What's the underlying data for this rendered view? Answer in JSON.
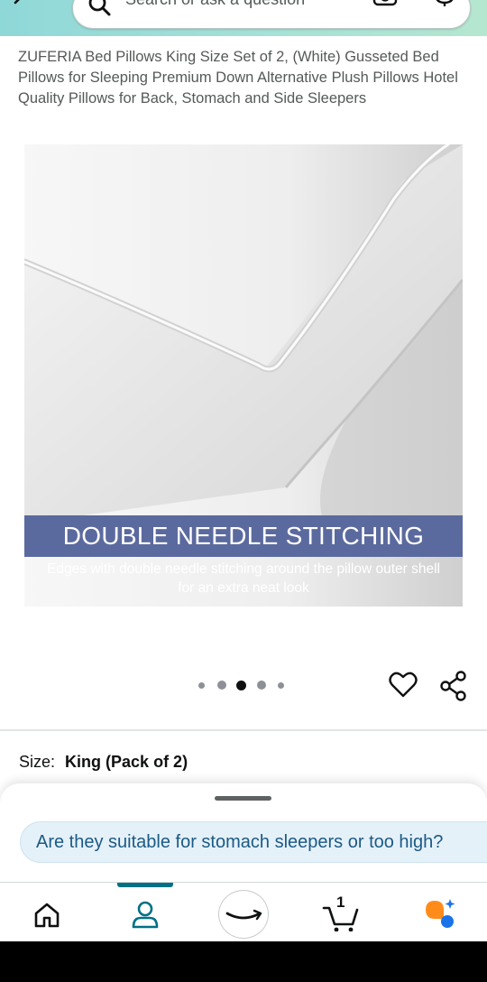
{
  "header": {
    "search_placeholder": "Search or ask a question",
    "back_icon": "chevron-left-icon",
    "search_icon": "search-icon",
    "camera_icon": "camera-lens-icon",
    "mic_icon": "microphone-icon",
    "gradient_colors": [
      "#8fd8d8",
      "#b5e6d0"
    ]
  },
  "product": {
    "title": "ZUFERIA Bed Pillows King Size Set of 2, (White) Gusseted Bed Pillows for Sleeping Premium Down Alternative Plush Pillows Hotel Quality Pillows for Back, Stomach and Side Sleepers",
    "image": {
      "banner_text": "DOUBLE NEEDLE STITCHING",
      "caption": "Edges with double needle stitching around the pillow outer shell for an extra neat look",
      "banner_color": "#5b6a9e"
    },
    "carousel": {
      "total": 5,
      "active_index": 2
    },
    "size_label": "Size:",
    "size_value": "King (Pack of 2)"
  },
  "sheet": {
    "question": "Are they suitable for stomach sleepers or too high?"
  },
  "nav": {
    "items": [
      "home-icon",
      "account-icon",
      "amazon-smile-icon",
      "cart-icon",
      "menu-icon"
    ],
    "active_index": 1,
    "cart_count": "1",
    "accent_color": "#007185"
  }
}
